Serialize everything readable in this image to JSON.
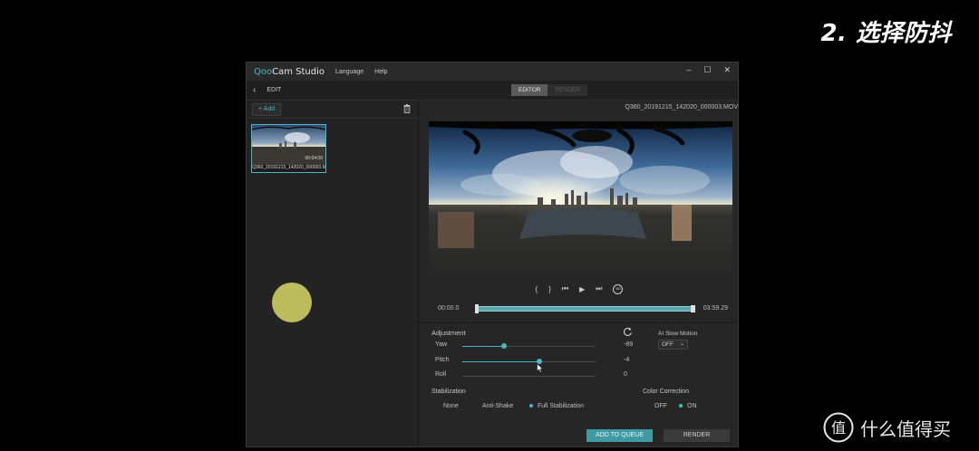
{
  "slide": {
    "title": "2. 选择防抖"
  },
  "app": {
    "logo_q": "Qoo",
    "logo_rest": "Cam Studio",
    "menu": [
      "Language",
      "Help"
    ],
    "window_controls": {
      "minimize": "–",
      "maximize": "☐",
      "close": "✕"
    }
  },
  "subbar": {
    "back": "‹",
    "edit_label": "EDIT",
    "tabs": [
      {
        "label": "EDITOR",
        "active": true
      },
      {
        "label": "RENDER",
        "active": false
      }
    ]
  },
  "library": {
    "add_label": "+ Add",
    "clip": {
      "duration": "00:04:00",
      "name": "Q360_20191215_142020_000003.MOV"
    }
  },
  "preview": {
    "filename": "Q360_20191215_142020_000003.MOV",
    "transport": {
      "mark_in": "{",
      "mark_out": "}",
      "prev": "⏮",
      "play": "▶",
      "next": "⏭",
      "vr": "360"
    }
  },
  "timeline": {
    "start": "00:00.0",
    "end": "03:59.29",
    "playhead_fraction": 0.0
  },
  "adjustment": {
    "title": "Adjustment",
    "sliders": [
      {
        "label": "Yaw",
        "value": "-89",
        "fraction": 0.31
      },
      {
        "label": "Pitch",
        "value": "-4",
        "fraction": 0.58
      },
      {
        "label": "Roll",
        "value": "0",
        "fraction": 0.0
      }
    ]
  },
  "ai_slow_motion": {
    "title": "AI Slow Motion",
    "value": "OFF"
  },
  "stabilization": {
    "title": "Stabilization",
    "options": [
      {
        "label": "None",
        "selected": false
      },
      {
        "label": "Anti-Shake",
        "selected": false
      },
      {
        "label": "Full Stabilization",
        "selected": true
      }
    ]
  },
  "color_correction": {
    "title": "Color Correction",
    "options": [
      {
        "label": "OFF",
        "selected": false
      },
      {
        "label": "ON",
        "selected": true
      }
    ]
  },
  "actions": {
    "queue": "ADD TO QUEUE",
    "render": "RENDER"
  },
  "watermark": {
    "text": "什么值得买",
    "logo_glyph": "值"
  },
  "colors": {
    "accent": "#48b6c6",
    "background": "#262626"
  }
}
